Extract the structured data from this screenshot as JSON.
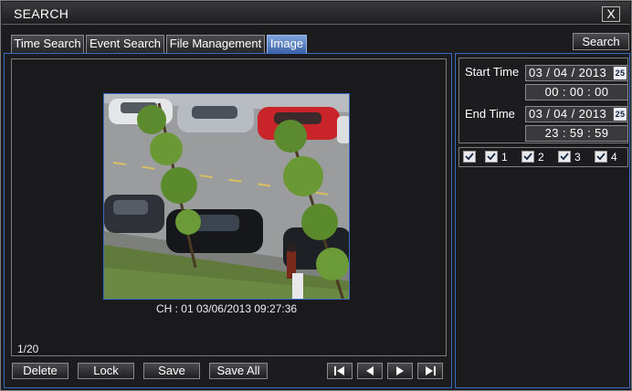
{
  "window": {
    "title": "SEARCH",
    "close_label": "X"
  },
  "tabs": [
    {
      "label": "Time Search",
      "active": false
    },
    {
      "label": "Event Search",
      "active": false
    },
    {
      "label": "File Management",
      "active": false
    },
    {
      "label": "Image",
      "active": true
    }
  ],
  "search_button": "Search",
  "preview": {
    "caption": "CH : 01   03/06/2013 09:27:36",
    "page_counter": "1/20"
  },
  "actions": {
    "delete": "Delete",
    "lock": "Lock",
    "save": "Save",
    "save_all": "Save All"
  },
  "navigation": [
    "first-page-icon",
    "previous-icon",
    "next-icon",
    "last-page-icon"
  ],
  "time_filter": {
    "start_label": "Start Time",
    "start_date": "03 / 04 / 2013",
    "start_time": "00  :  00  :  00",
    "end_label": "End Time",
    "end_date": "03 / 04 / 2013",
    "end_time": "23  :  59  :  59",
    "calendar_icon_text": "25"
  },
  "channels": {
    "all_checked": true,
    "items": [
      {
        "label": "1",
        "checked": true
      },
      {
        "label": "2",
        "checked": true
      },
      {
        "label": "3",
        "checked": true
      },
      {
        "label": "4",
        "checked": true
      }
    ]
  },
  "colors": {
    "accent_border": "#3b6bc4",
    "active_tab": "#5a82c4",
    "background": "#1c1c1e"
  }
}
